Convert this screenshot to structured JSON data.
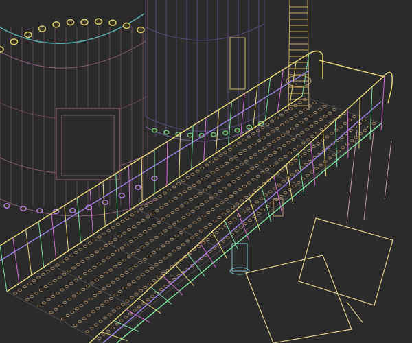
{
  "scene": {
    "colors": {
      "background": "#2b2b2b",
      "tank_lines": "#6b4a5a",
      "tank2_lines": "#5a4a7a",
      "rail_yellow": "#e6d77a",
      "rail_green": "#7fe0a0",
      "rail_purple": "#9a80e0",
      "rail_pink": "#d070d0",
      "deck_dots": "#c8a070",
      "rivet_yellow": "#d8cc70",
      "rivet_purple": "#b080e0",
      "rivet_green": "#70c080",
      "pipe": "#c8a860",
      "panel": "#e0d090"
    },
    "deck_panels": 7,
    "dot_rows": 8,
    "dot_cols": 9
  }
}
